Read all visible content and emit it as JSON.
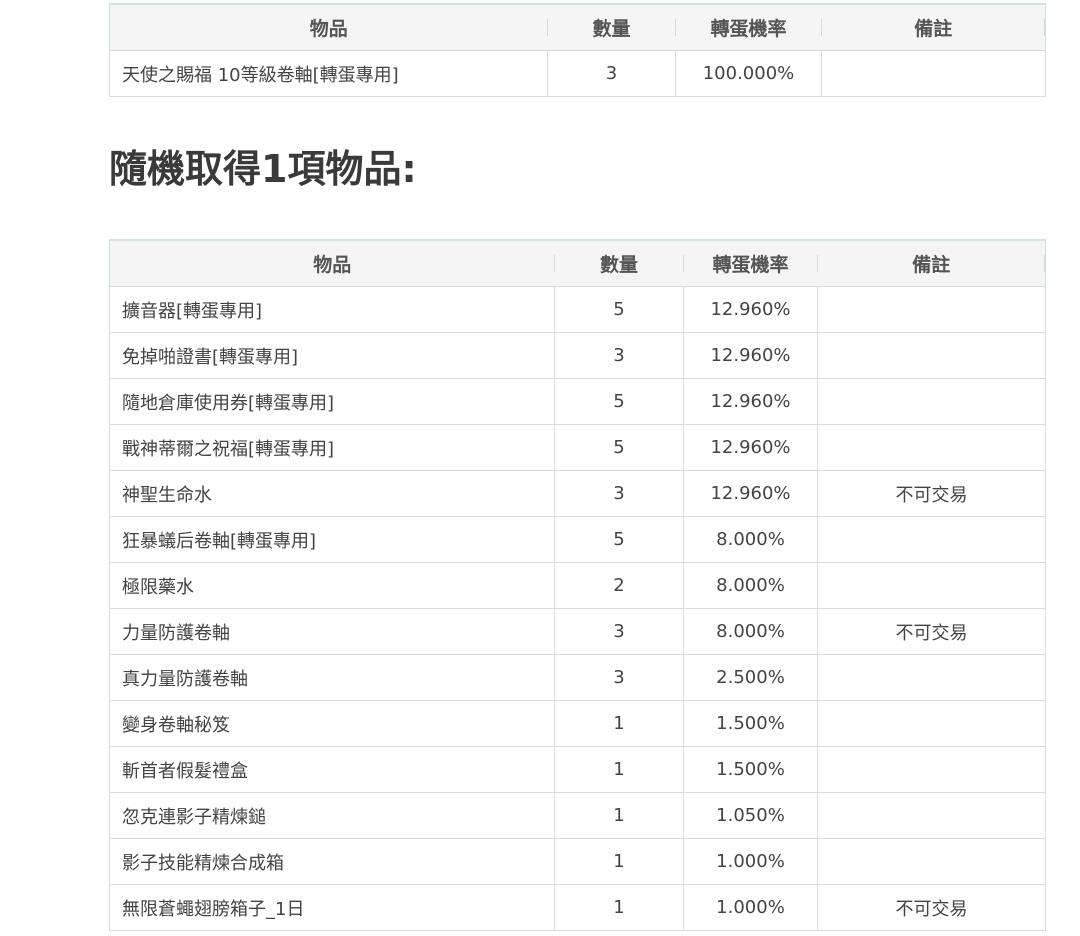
{
  "headers": {
    "item": "物品",
    "qty": "數量",
    "rate": "轉蛋機率",
    "note": "備註"
  },
  "table1": {
    "rows": [
      {
        "item": "天使之賜福 10等級卷軸[轉蛋專用]",
        "qty": "3",
        "rate": "100.000%",
        "note": ""
      }
    ]
  },
  "section_heading": "隨機取得1項物品:",
  "table2": {
    "rows": [
      {
        "item": "擴音器[轉蛋專用]",
        "qty": "5",
        "rate": "12.960%",
        "note": ""
      },
      {
        "item": "免掉啪證書[轉蛋專用]",
        "qty": "3",
        "rate": "12.960%",
        "note": ""
      },
      {
        "item": "隨地倉庫使用券[轉蛋專用]",
        "qty": "5",
        "rate": "12.960%",
        "note": ""
      },
      {
        "item": "戰神蒂爾之祝福[轉蛋專用]",
        "qty": "5",
        "rate": "12.960%",
        "note": ""
      },
      {
        "item": "神聖生命水",
        "qty": "3",
        "rate": "12.960%",
        "note": "不可交易"
      },
      {
        "item": "狂暴蟻后卷軸[轉蛋專用]",
        "qty": "5",
        "rate": "8.000%",
        "note": ""
      },
      {
        "item": "極限藥水",
        "qty": "2",
        "rate": "8.000%",
        "note": ""
      },
      {
        "item": "力量防護卷軸",
        "qty": "3",
        "rate": "8.000%",
        "note": "不可交易"
      },
      {
        "item": "真力量防護卷軸",
        "qty": "3",
        "rate": "2.500%",
        "note": ""
      },
      {
        "item": "變身卷軸秘笈",
        "qty": "1",
        "rate": "1.500%",
        "note": ""
      },
      {
        "item": "斬首者假髮禮盒",
        "qty": "1",
        "rate": "1.500%",
        "note": ""
      },
      {
        "item": "忽克連影子精煉鎚",
        "qty": "1",
        "rate": "1.050%",
        "note": ""
      },
      {
        "item": "影子技能精煉合成箱",
        "qty": "1",
        "rate": "1.000%",
        "note": ""
      },
      {
        "item": "無限蒼蠅翅膀箱子_1日",
        "qty": "1",
        "rate": "1.000%",
        "note": "不可交易"
      }
    ]
  }
}
